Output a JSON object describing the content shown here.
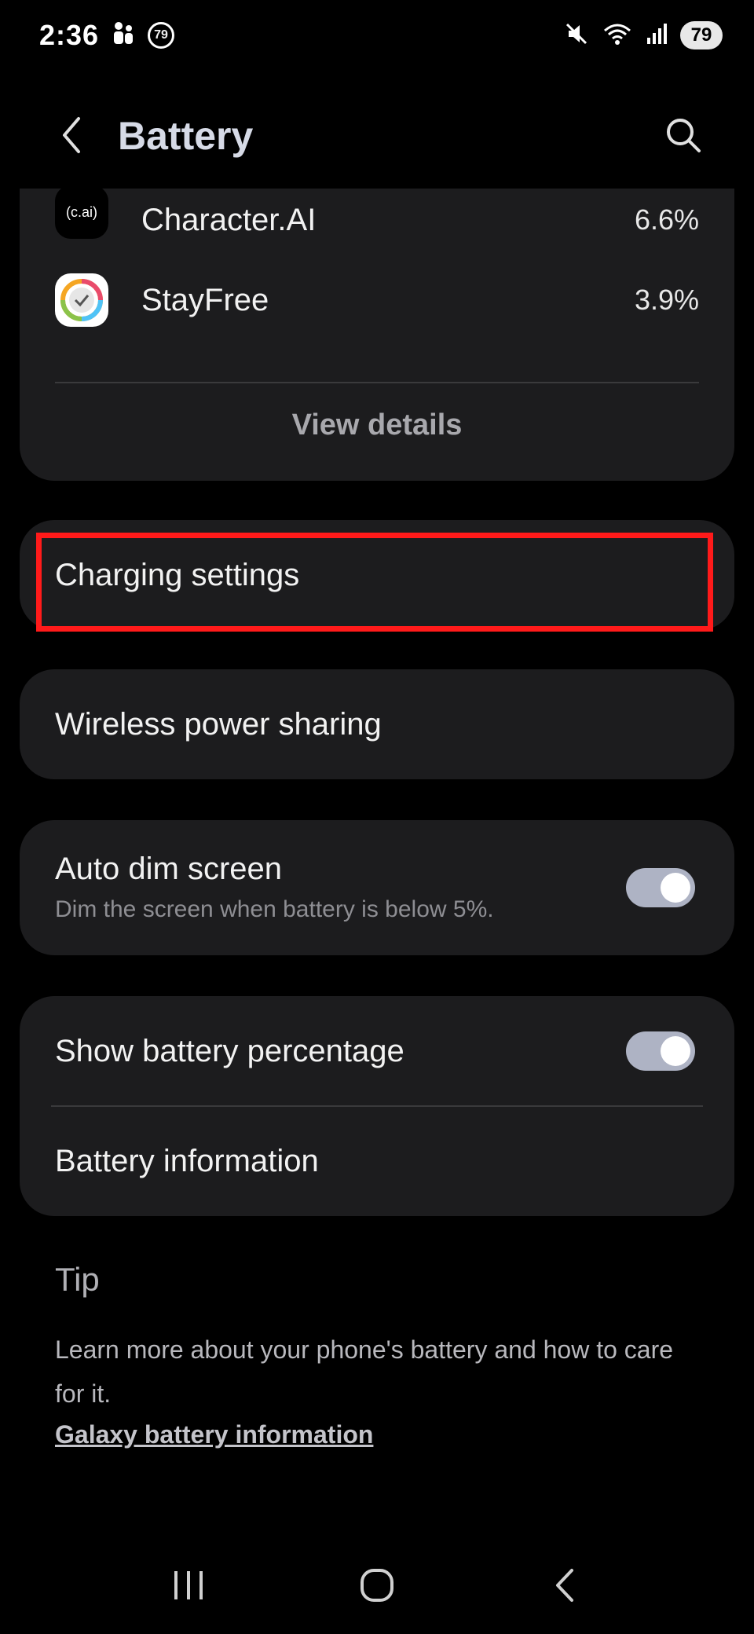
{
  "status_bar": {
    "time": "2:36",
    "notification_badge": "79",
    "battery_level": "79",
    "icons": [
      "people-icon",
      "mute-icon",
      "wifi-icon",
      "signal-icon"
    ]
  },
  "header": {
    "title": "Battery",
    "back_icon": "chevron-left-icon",
    "search_icon": "search-icon"
  },
  "app_usage": {
    "apps": [
      {
        "name": "Character.AI",
        "icon_text": "(c.ai)",
        "percent": "6.6%"
      },
      {
        "name": "StayFree",
        "percent": "3.9%"
      }
    ],
    "view_details_label": "View details"
  },
  "settings": {
    "charging_settings": "Charging settings",
    "wireless_power_sharing": "Wireless power sharing",
    "auto_dim": {
      "title": "Auto dim screen",
      "subtitle": "Dim the screen when battery is below 5%.",
      "enabled": true
    },
    "show_battery_percentage": {
      "title": "Show battery percentage",
      "enabled": true
    },
    "battery_information": "Battery information"
  },
  "tip": {
    "title": "Tip",
    "text": "Learn more about your phone's battery and how to care for it.",
    "link": "Galaxy battery information"
  },
  "nav_bar": {
    "icons": [
      "recents-icon",
      "home-icon",
      "back-icon"
    ]
  },
  "colors": {
    "background": "#000000",
    "card": "#1c1c1e",
    "toggle_on": "#aeb3c4",
    "highlight": "#ff1a1a"
  }
}
